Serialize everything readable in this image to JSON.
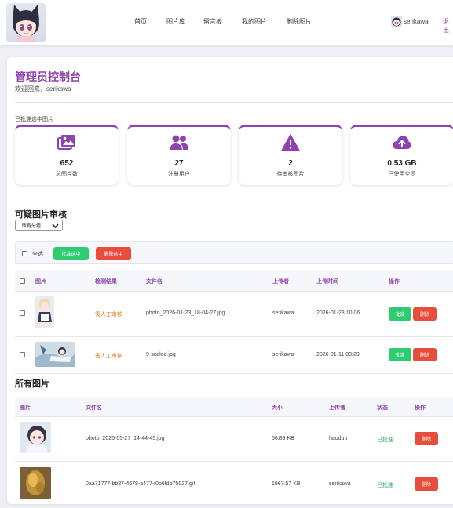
{
  "nav": {
    "items": [
      "首页",
      "图片库",
      "留言板",
      "我的图片",
      "删除图片"
    ],
    "username": "serikawa",
    "logout": "退出"
  },
  "header": {
    "title": "管理员控制台",
    "welcome": "欢迎回来，serikawa",
    "approved_message": "已批准选中图片"
  },
  "stats": [
    {
      "icon": "images-icon",
      "value": "652",
      "label": "总图片数"
    },
    {
      "icon": "users-icon",
      "value": "27",
      "label": "注册用户"
    },
    {
      "icon": "warning-icon",
      "value": "2",
      "label": "待审核图片"
    },
    {
      "icon": "cloud-upload-icon",
      "value": "0.53 GB",
      "label": "已使用空间"
    }
  ],
  "review": {
    "title": "可疑图片审核",
    "filter_selected": "所有分组",
    "select_all": "全选",
    "approve_selected": "批准选中",
    "delete_selected": "删除选中",
    "columns": [
      "图片",
      "检测结果",
      "文件名",
      "上传者",
      "上传时间",
      "操作"
    ],
    "rows": [
      {
        "result": "需人工审核",
        "filename": "photo_2026-01-23_18-04-27.jpg",
        "uploader": "serikawa",
        "time": "2026-01-23 10:06",
        "approve": "批准",
        "delete": "删除"
      },
      {
        "result": "需人工审核",
        "filename": "9-scaled.jpg",
        "uploader": "serikawa",
        "time": "2026-01-11 03:29",
        "approve": "批准",
        "delete": "删除"
      }
    ]
  },
  "all_images": {
    "title": "所有图片",
    "columns": [
      "图片",
      "文件名",
      "大小",
      "上传者",
      "状态",
      "操作"
    ],
    "rows": [
      {
        "filename": "photo_2025-05-27_14-44-45.jpg",
        "size": "56.89 KB",
        "uploader": "haodun",
        "status": "已批准",
        "delete": "删除"
      },
      {
        "filename": "0aa71777-bb87-4678-a477-f0b6fdb75027.gif",
        "size": "1967.57 KB",
        "uploader": "serikawa",
        "status": "已批准",
        "delete": "删除"
      }
    ]
  },
  "colors": {
    "accent": "#8e44ad",
    "approve": "#2ecc71",
    "delete": "#e74c3c",
    "warning": "#e67e22",
    "approved": "#27ae60"
  }
}
